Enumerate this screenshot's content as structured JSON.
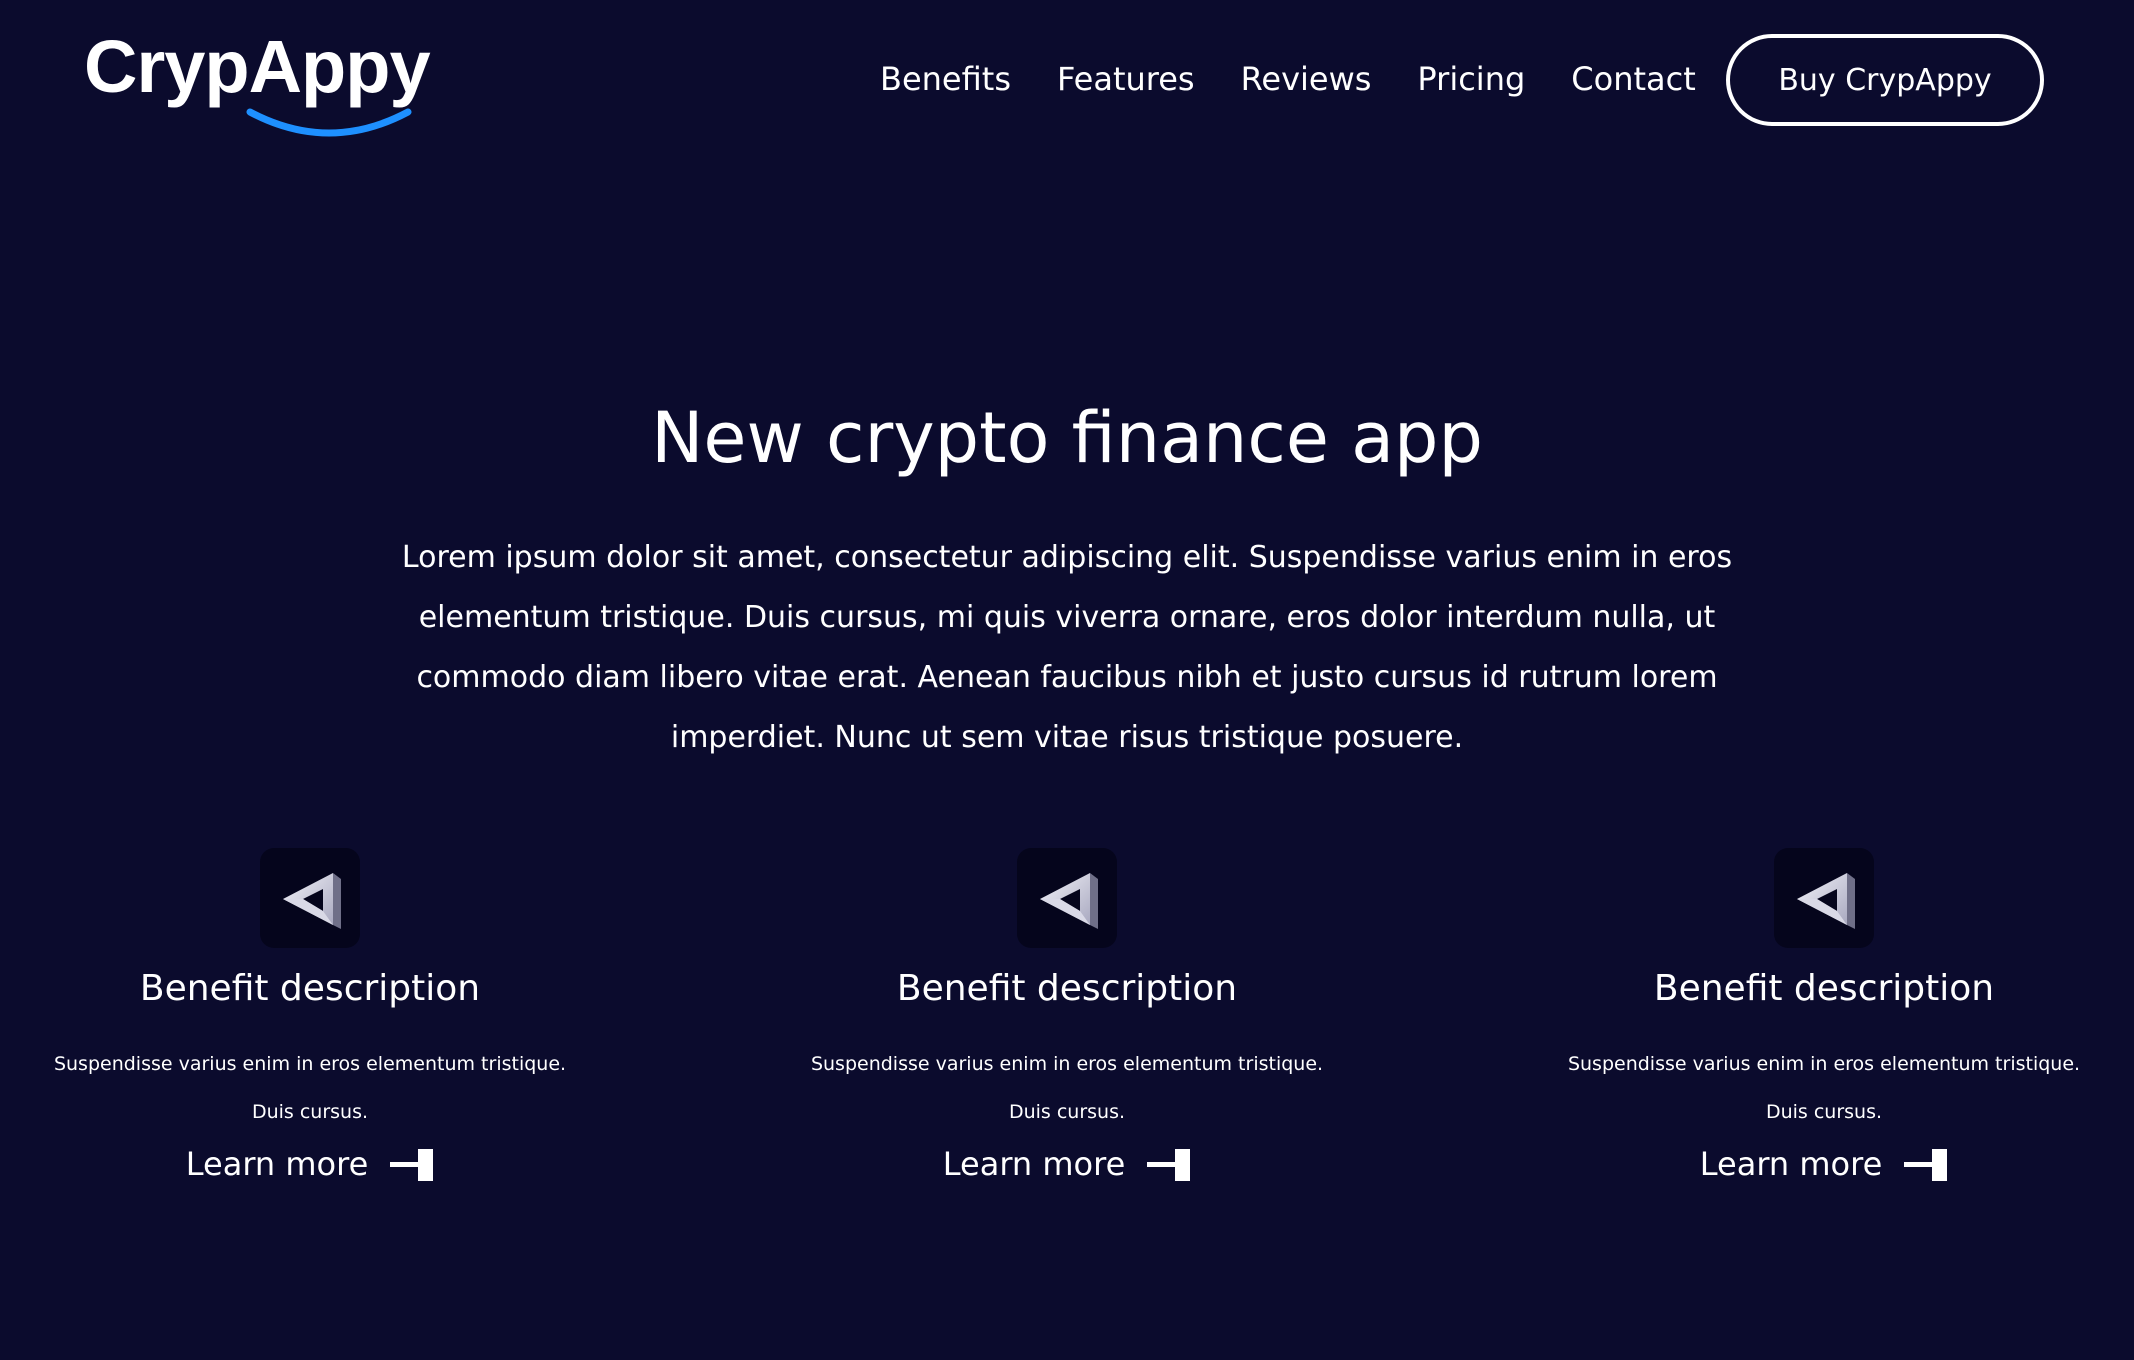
{
  "brand": {
    "logo_text": "CrypAppy",
    "accent_color": "#1e90ff",
    "background_color": "#0b0b2d"
  },
  "nav": {
    "links": [
      "Benefits",
      "Features",
      "Reviews",
      "Pricing",
      "Contact"
    ],
    "cta_label": "Buy CrypAppy"
  },
  "hero": {
    "title": "New crypto finance app",
    "text": "Lorem ipsum dolor sit amet, consectetur adipiscing elit. Suspendisse varius enim in eros elementum tristique. Duis cursus, mi quis viverra ornare, eros dolor interdum nulla, ut commodo diam libero vitae erat. Aenean faucibus nibh et justo cursus id rutrum lorem imperdiet. Nunc ut sem vitae risus tristique posuere."
  },
  "benefits": [
    {
      "icon": "impossible-triangle-icon",
      "title": "Benefit description",
      "description": "Suspendisse varius enim in eros elementum tristique. Duis cursus.",
      "link_label": "Learn more"
    },
    {
      "icon": "impossible-triangle-icon",
      "title": "Benefit description",
      "description": "Suspendisse varius enim in eros elementum tristique. Duis cursus.",
      "link_label": "Learn more"
    },
    {
      "icon": "impossible-triangle-icon",
      "title": "Benefit description",
      "description": "Suspendisse varius enim in eros elementum tristique. Duis cursus.",
      "link_label": "Learn more"
    }
  ]
}
